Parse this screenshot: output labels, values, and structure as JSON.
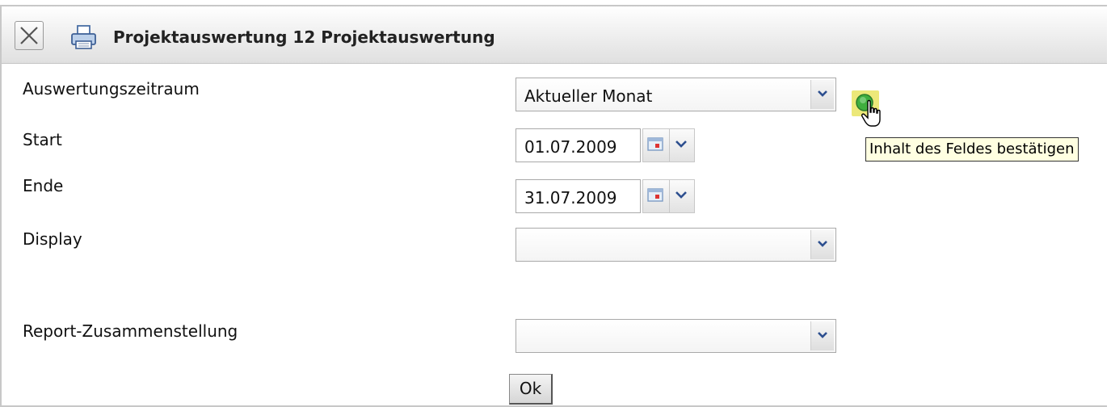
{
  "window": {
    "title": "Projektauswertung 12 Projektauswertung",
    "close_icon": "close-icon",
    "print_icon": "printer-icon"
  },
  "form": {
    "period_label": "Auswertungszeitraum",
    "period_value": "Aktueller Monat",
    "start_label": "Start",
    "start_value": "01.07.2009",
    "end_label": "Ende",
    "end_value": "31.07.2009",
    "display_label": "Display",
    "display_value": "",
    "report_label": "Report-Zusammenstellung",
    "report_value": "",
    "ok_label": "Ok"
  },
  "confirm": {
    "icon": "green-check-circle-icon",
    "tooltip": "Inhalt des Feldes bestätigen"
  },
  "colors": {
    "header_bg": "#e8e8e8",
    "tooltip_bg": "#ffffe1",
    "confirm_bg": "#ece879",
    "confirm_icon": "#3fae3f"
  }
}
